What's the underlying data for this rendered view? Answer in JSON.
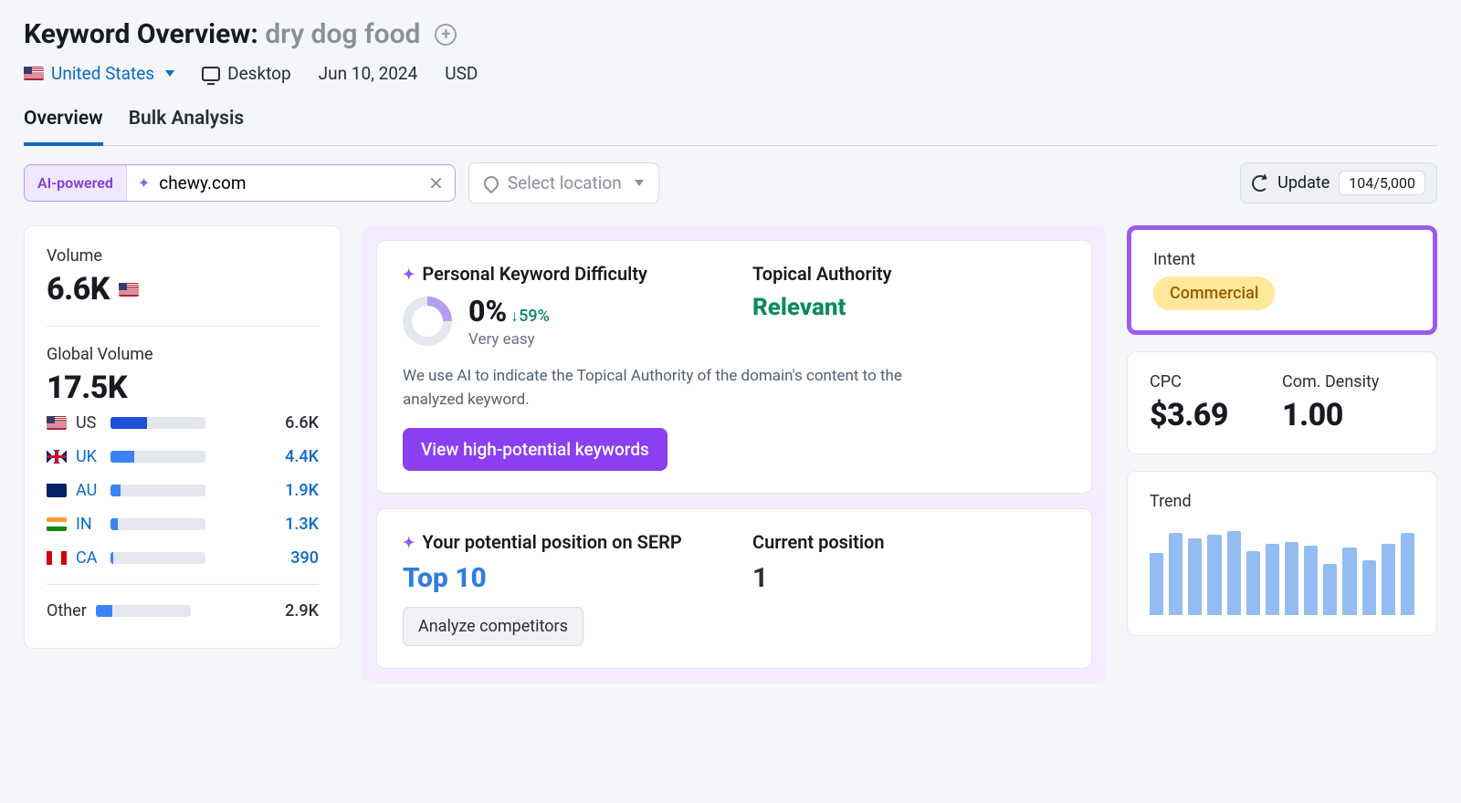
{
  "header": {
    "title_prefix": "Keyword Overview:",
    "keyword": "dry dog food",
    "country": "United States",
    "device": "Desktop",
    "date": "Jun 10, 2024",
    "currency": "USD"
  },
  "tabs": {
    "overview": "Overview",
    "bulk": "Bulk Analysis"
  },
  "filters": {
    "ai_label": "AI-powered",
    "domain_value": "chewy.com",
    "location_placeholder": "Select location",
    "update_label": "Update",
    "quota": "104/5,000"
  },
  "volume": {
    "label": "Volume",
    "value": "6.6K",
    "global_label": "Global Volume",
    "global_value": "17.5K",
    "countries": [
      {
        "code": "US",
        "flag": "us",
        "value": "6.6K",
        "pct": 38,
        "link": false
      },
      {
        "code": "UK",
        "flag": "uk",
        "value": "4.4K",
        "pct": 25,
        "link": true
      },
      {
        "code": "AU",
        "flag": "au",
        "value": "1.9K",
        "pct": 11,
        "link": true
      },
      {
        "code": "IN",
        "flag": "in",
        "value": "1.3K",
        "pct": 8,
        "link": true
      },
      {
        "code": "CA",
        "flag": "ca",
        "value": "390",
        "pct": 3,
        "link": true
      }
    ],
    "other_label": "Other",
    "other_value": "2.9K",
    "other_pct": 17
  },
  "pkd": {
    "title": "Personal Keyword Difficulty",
    "pct": "0%",
    "delta": "↓59%",
    "sub": "Very easy",
    "topical_title": "Topical Authority",
    "topical_value": "Relevant",
    "desc": "We use AI to indicate the Topical Authority of the domain's content to the analyzed keyword.",
    "cta": "View high-potential keywords"
  },
  "serp": {
    "pot_title": "Your potential position on SERP",
    "pot_value": "Top 10",
    "cur_title": "Current position",
    "cur_value": "1",
    "analyze": "Analyze competitors"
  },
  "intent": {
    "label": "Intent",
    "value": "Commercial"
  },
  "cpc": {
    "cpc_label": "CPC",
    "cpc_value": "$3.69",
    "den_label": "Com. Density",
    "den_value": "1.00"
  },
  "trend": {
    "label": "Trend",
    "bars_pct": [
      68,
      90,
      84,
      88,
      92,
      70,
      78,
      80,
      76,
      56,
      74,
      60,
      78,
      90
    ]
  },
  "chart_data": {
    "type": "bar",
    "title": "Trend",
    "categories": [
      "1",
      "2",
      "3",
      "4",
      "5",
      "6",
      "7",
      "8",
      "9",
      "10",
      "11",
      "12",
      "13",
      "14"
    ],
    "values": [
      68,
      90,
      84,
      88,
      92,
      70,
      78,
      80,
      76,
      56,
      74,
      60,
      78,
      90
    ],
    "ylim": [
      0,
      100
    ],
    "xlabel": "",
    "ylabel": ""
  }
}
